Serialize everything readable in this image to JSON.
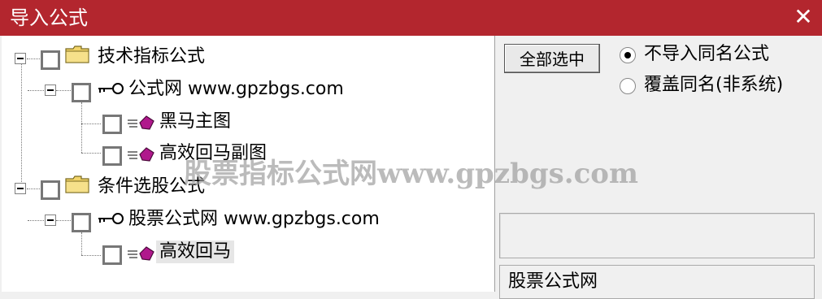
{
  "window": {
    "title": "导入公式",
    "close_glyph": "✕"
  },
  "tree": {
    "nodes": [
      {
        "label": "技术指标公式",
        "icon": "folder-icon"
      },
      {
        "label": "公式网 www.gpzbgs.com",
        "icon": "key-icon"
      },
      {
        "label": "黑马主图",
        "icon": "formula-icon"
      },
      {
        "label": "高效回马副图",
        "icon": "formula-icon"
      },
      {
        "label": "条件选股公式",
        "icon": "folder-icon"
      },
      {
        "label": "股票公式网 www.gpzbgs.com",
        "icon": "key-icon"
      },
      {
        "label": "高效回马",
        "icon": "formula-icon"
      }
    ]
  },
  "controls": {
    "select_all_label": "全部选中",
    "radio_options": [
      {
        "label": "不导入同名公式",
        "selected": true
      },
      {
        "label": "覆盖同名(非系统)",
        "selected": false
      }
    ],
    "info_text": "股票公式网"
  },
  "watermark": "股票指标公式网www.gpzbgs.com",
  "colors": {
    "titlebar": "#b3262e",
    "folder": "#f2d46a",
    "formula": "#b0188c"
  }
}
